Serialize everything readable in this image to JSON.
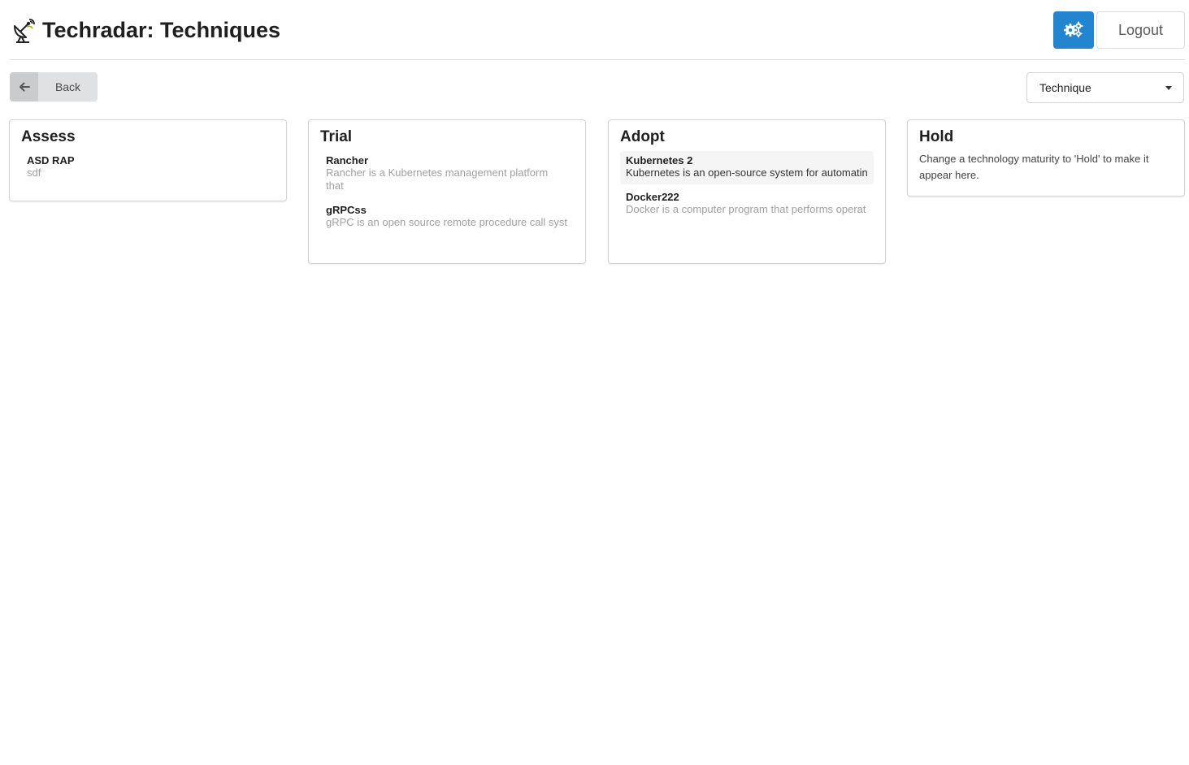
{
  "header": {
    "title": "Techradar: Techniques",
    "app_icon": "satellite-dish-icon",
    "settings_icon": "cogs-icon",
    "logout_label": "Logout",
    "accent_color": "#2185d0"
  },
  "toolbar": {
    "back_label": "Back",
    "back_icon": "arrow-left-icon",
    "type_select": {
      "selected": "Technique"
    }
  },
  "columns": [
    {
      "title": "Assess",
      "items": [
        {
          "name": "ASD RAP",
          "description": "sdf"
        }
      ]
    },
    {
      "title": "Trial",
      "items": [
        {
          "name": "Rancher",
          "description": "Rancher is a Kubernetes management platform that"
        },
        {
          "name": "gRPCss",
          "description": "gRPC is an open source remote procedure call syst"
        }
      ]
    },
    {
      "title": "Adopt",
      "items": [
        {
          "name": "Kubernetes 2",
          "description": "Kubernetes is an open-source system for automatin"
        },
        {
          "name": "Docker222",
          "description": "Docker is a computer program that performs operat"
        }
      ]
    },
    {
      "title": "Hold",
      "empty_message": "Change a technology maturity to 'Hold' to make it appear here."
    }
  ]
}
